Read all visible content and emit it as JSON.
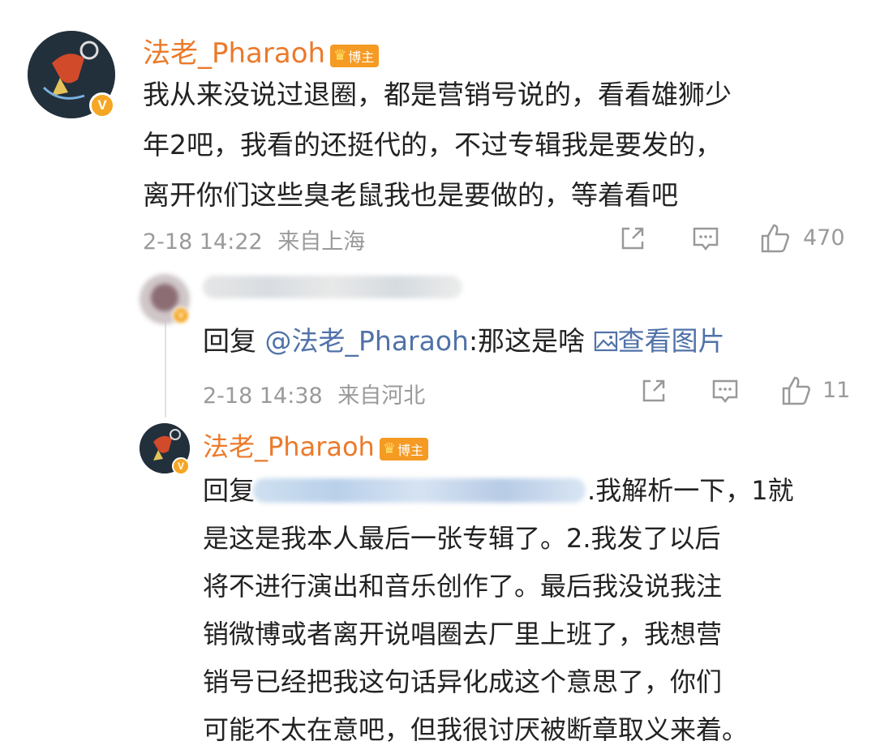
{
  "comment": {
    "username": "法老_Pharaoh",
    "badge": "博主",
    "text_lines": [
      "我从来没说过退圈，都是营销号说的，看看雄狮少",
      "年2吧，我看的还挺代的，不过专辑我是要发的，",
      "离开你们这些臭老鼠我也是要做的，等着看吧"
    ],
    "timestamp": "2-18 14:22",
    "location": "来自上海",
    "likes": "470"
  },
  "reply1": {
    "prefix": "回复 ",
    "mention": "@法老_Pharaoh",
    "text": ":那这是啥",
    "image_link": "查看图片",
    "timestamp": "2-18 14:38",
    "location": "来自河北",
    "likes": "11"
  },
  "reply2": {
    "username": "法老_Pharaoh",
    "badge": "博主",
    "first_prefix": "回复",
    "first_rest": ".我解析一下，1就",
    "text_lines": [
      "是这是我本人最后一张专辑了。2.我发了以后",
      "将不进行演出和音乐创作了。最后我没说我注",
      "销微博或者离开说唱圈去厂里上班了，我想营",
      "销号已经把我这句话异化成这个意思了，你们",
      "可能不太在意吧，但我很讨厌被断章取义来着。"
    ]
  },
  "icons": {
    "verified": "V",
    "badge_crown": "crown-icon",
    "share": "share-icon",
    "comment": "comment-icon",
    "like": "thumbs-up-icon",
    "image": "image-icon"
  },
  "colors": {
    "username": "#eb7a2b",
    "link": "#5072a8",
    "meta": "#9a9a9a",
    "badge": "#f59a23"
  }
}
